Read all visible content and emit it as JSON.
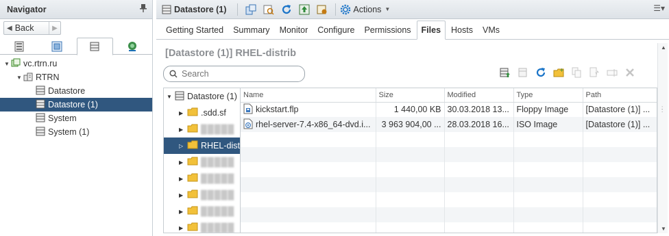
{
  "navigator": {
    "title": "Navigator",
    "back_label": "Back",
    "tree": [
      {
        "label": "vc.rtrn.ru",
        "icon": "vcenter-icon",
        "level": 0,
        "expanded": true
      },
      {
        "label": "RTRN",
        "icon": "datacenter-icon",
        "level": 1,
        "expanded": true
      },
      {
        "label": "Datastore",
        "icon": "datastore-icon",
        "level": 2
      },
      {
        "label": "Datastore (1)",
        "icon": "datastore-icon",
        "level": 2,
        "selected": true
      },
      {
        "label": "System",
        "icon": "datastore-icon",
        "level": 2
      },
      {
        "label": "System (1)",
        "icon": "datastore-icon",
        "level": 2
      }
    ]
  },
  "toolbar": {
    "title": "Datastore (1)",
    "actions_label": "Actions"
  },
  "tabs": [
    "Getting Started",
    "Summary",
    "Monitor",
    "Configure",
    "Permissions",
    "Files",
    "Hosts",
    "VMs"
  ],
  "selected_tab": "Files",
  "path_title": "[Datastore (1)] RHEL-distrib",
  "search": {
    "placeholder": "Search"
  },
  "folder_tree": [
    {
      "label": "Datastore (1)",
      "level": 0
    },
    {
      "label": ".sdd.sf",
      "level": 1
    },
    {
      "label": "",
      "level": 1,
      "blurred": true
    },
    {
      "label": "RHEL-dist",
      "level": 1,
      "selected": true
    },
    {
      "label": "",
      "level": 1,
      "blurred": true
    },
    {
      "label": "",
      "level": 1,
      "blurred": true
    },
    {
      "label": "",
      "level": 1,
      "blurred": true
    },
    {
      "label": "",
      "level": 1,
      "blurred": true
    },
    {
      "label": "",
      "level": 1,
      "blurred": true
    }
  ],
  "grid": {
    "columns": [
      "Name",
      "Size",
      "Modified",
      "Type",
      "Path"
    ],
    "rows": [
      [
        "kickstart.flp",
        "1 440,00 KB",
        "30.03.2018 13...",
        "Floppy Image",
        "[Datastore (1)] ..."
      ],
      [
        "rhel-server-7.4-x86_64-dvd.i...",
        "3 963 904,00 ...",
        "28.03.2018 16...",
        "ISO Image",
        "[Datastore (1)] ..."
      ]
    ],
    "row_icons": [
      "floppy-file-icon",
      "iso-file-icon"
    ]
  },
  "colors": {
    "selection": "#30577f",
    "accent": "#1a74c8"
  }
}
